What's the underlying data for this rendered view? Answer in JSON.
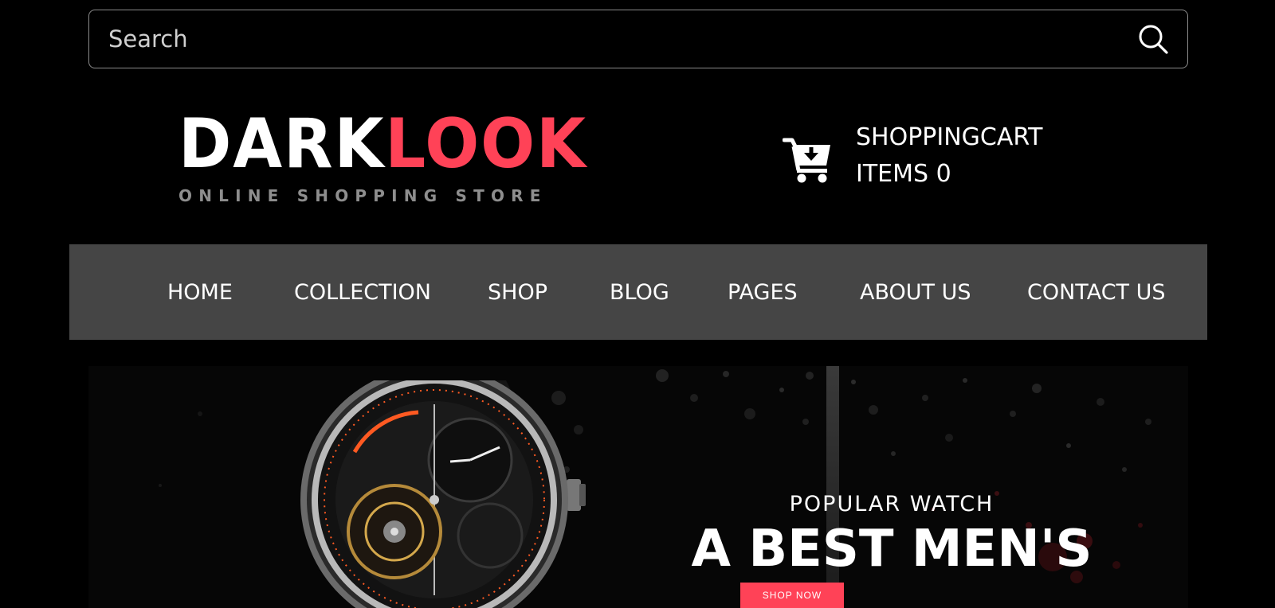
{
  "search": {
    "placeholder": "Search"
  },
  "brand": {
    "name_part1": "DARK",
    "name_part2": "LOOK",
    "tagline": "ONLINE SHOPPING STORE",
    "accent_color": "#ff4257"
  },
  "cart": {
    "title": "SHOPPINGCART",
    "items_text": "ITEMS 0",
    "icon": "cart-download-icon"
  },
  "nav": {
    "items": [
      {
        "label": "HOME"
      },
      {
        "label": "COLLECTION"
      },
      {
        "label": "SHOP"
      },
      {
        "label": "BLOG"
      },
      {
        "label": "PAGES"
      },
      {
        "label": "ABOUT US"
      },
      {
        "label": "CONTACT US"
      }
    ]
  },
  "banner": {
    "subtitle": "POPULAR WATCH",
    "title": "A BEST MEN'S",
    "button_label": "SHOP NOW"
  }
}
